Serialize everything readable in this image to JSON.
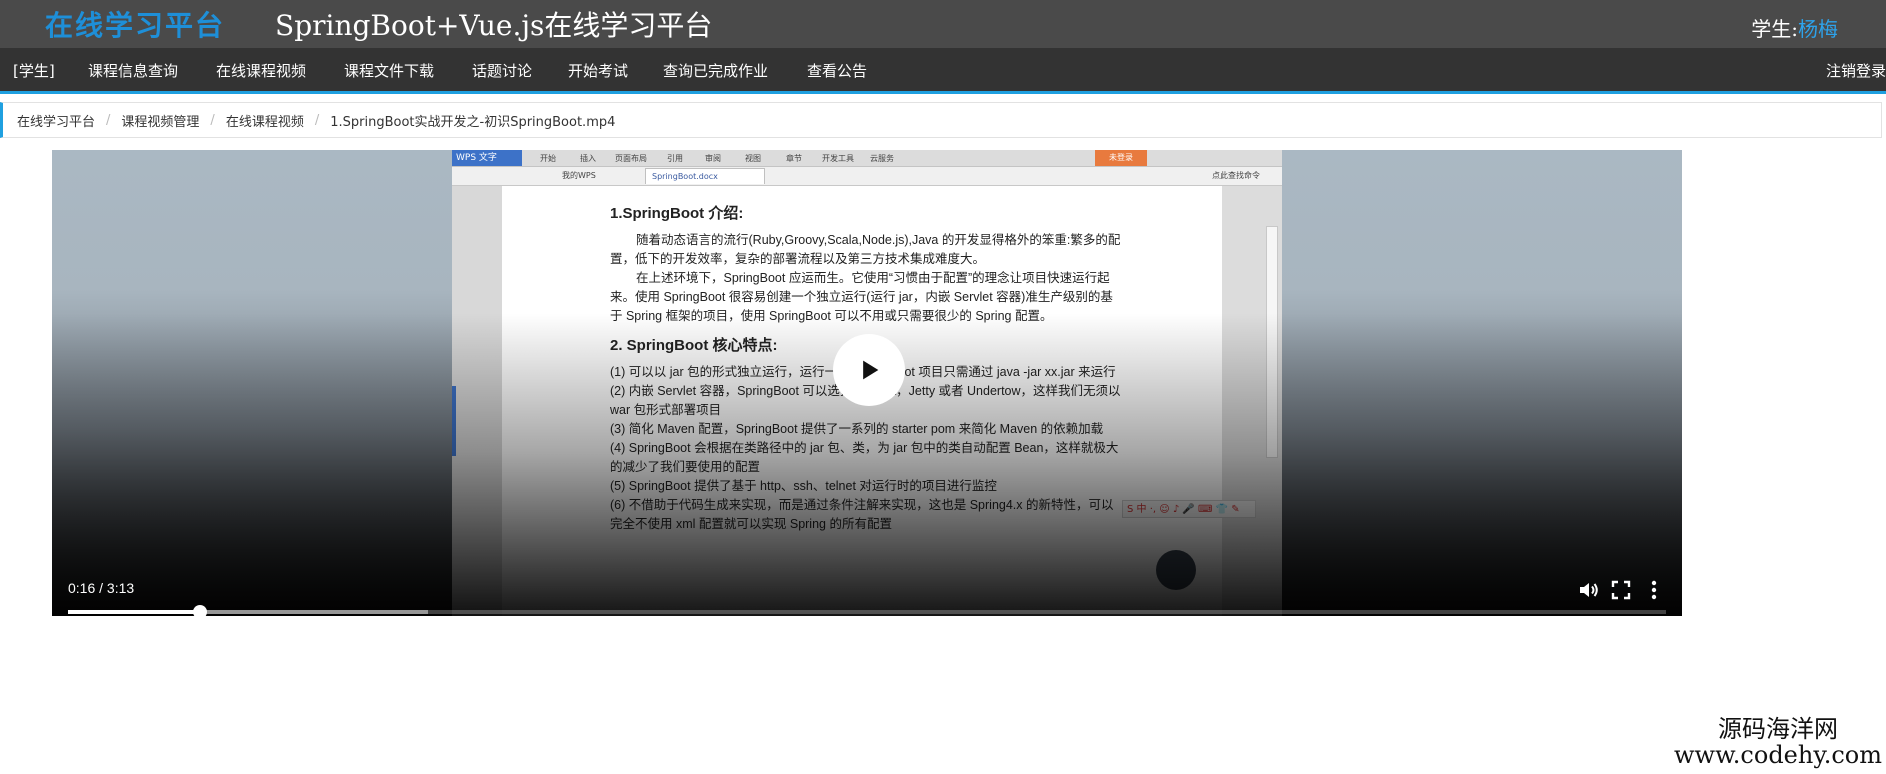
{
  "header": {
    "brand": "在线学习平台",
    "title": "SpringBoot+Vue.js在线学习平台",
    "user_prefix": "学生:",
    "user_name": "杨梅"
  },
  "nav": {
    "items": [
      "[学生]",
      "课程信息查询",
      "在线课程视频",
      "课程文件下载",
      "话题讨论",
      "开始考试",
      "查询已完成作业",
      "查看公告"
    ],
    "logout": "注销登录"
  },
  "breadcrumb": {
    "items": [
      "在线学习平台",
      "课程视频管理",
      "在线课程视频"
    ],
    "current": "1.SpringBoot实战开发之-初识SpringBoot.mp4"
  },
  "video": {
    "time": "0:16 / 3:13",
    "progress": 0.0827,
    "buffered": 0.225,
    "frame": {
      "app_label": "WPS 文字",
      "menus": [
        "开始",
        "插入",
        "页面布局",
        "引用",
        "审阅",
        "视图",
        "章节",
        "开发工具",
        "云服务"
      ],
      "login_label": "未登录",
      "tab_label": "SpringBoot.docx",
      "tab2_label": "我的WPS",
      "search_label": "点此查找命令",
      "heading1": "1.SpringBoot 介绍:",
      "para1": "随着动态语言的流行(Ruby,Groovy,Scala,Node.js),Java 的开发显得格外的笨重:繁多的配置，低下的开发效率，复杂的部署流程以及第三方技术集成难度大。",
      "para2": "在上述环境下，SpringBoot 应运而生。它使用“习惯由于配置”的理念让项目快速运行起来。使用 SpringBoot 很容易创建一个独立运行(运行 jar，内嵌 Servlet 容器)准生产级别的基于 Spring 框架的项目，使用 SpringBoot 可以不用或只需要很少的 Spring 配置。",
      "heading2": "2. SpringBoot 核心特点:",
      "list": [
        "(1) 可以以 jar 包的形式独立运行，运行一个 SpringBoot 项目只需通过 java -jar xx.jar 来运行",
        "(2) 内嵌 Servlet 容器，SpringBoot 可以选择 Tomcat，Jetty 或者 Undertow，这样我们无须以 war 包形式部署项目",
        "(3) 简化 Maven 配置，SpringBoot 提供了一系列的 starter pom 来简化 Maven 的依赖加载",
        "(4) SpringBoot 会根据在类路径中的 jar 包、类，为 jar 包中的类自动配置 Bean，这样就极大的减少了我们要使用的配置",
        "(5) SpringBoot 提供了基于 http、ssh、telnet 对运行时的项目进行监控",
        "(6) 不借助于代码生成来实现，而是通过条件注解来实现，这也是 Spring4.x 的新特性，可以完全不使用 xml 配置就可以实现 Spring 的所有配置"
      ],
      "sogou_label": "S 中 ·, ☺ ♪ 🎤 ⌨ 👕 ✎"
    }
  },
  "watermark": {
    "line1": "源码海洋网",
    "line2": "www.codehy.com"
  },
  "colors": {
    "header_bg": "#4a4a4a",
    "nav_bg": "#333333",
    "accent": "#1fa0e0",
    "brand": "#1e8fd8"
  },
  "icons": [
    "play-icon",
    "volume-icon",
    "fullscreen-icon",
    "more-vert-icon"
  ]
}
